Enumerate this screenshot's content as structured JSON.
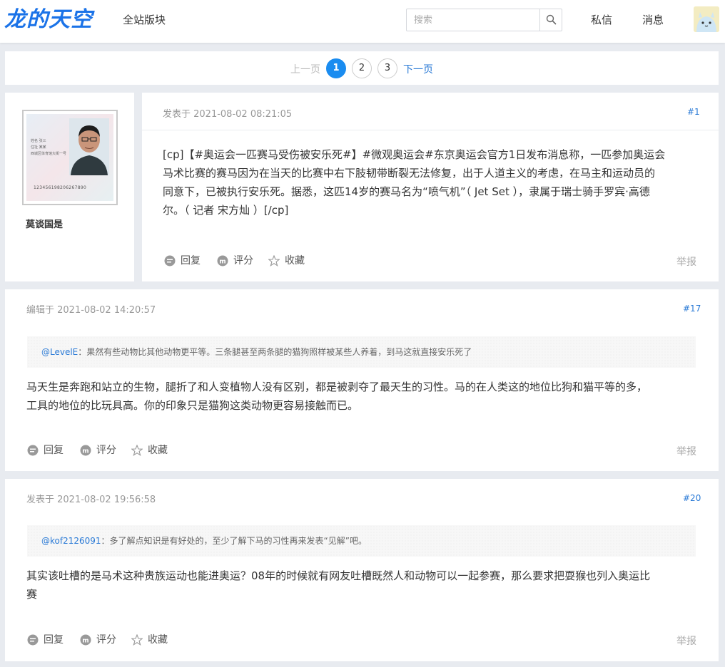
{
  "header": {
    "logo": "龙的天空",
    "nav_all": "全站版块",
    "search_placeholder": "搜索",
    "messages_label": "私信",
    "notifications_label": "消息"
  },
  "pager": {
    "prev": "上一页",
    "pages": [
      "1",
      "2",
      "3"
    ],
    "current": "1",
    "next": "下一页"
  },
  "op": {
    "username": "莫谈国是",
    "date": "发表于 2021-08-02 08:21:05",
    "floor": "#1",
    "lines": [
      "[cp]【#奥运会一匹赛马受伤被安乐死#】#微观奥运会#东京奥运会官方1日发布消息称，一匹参加奥运会",
      "马术比赛的赛马因为在当天的比赛中右下肢韧带断裂无法修复，出于人道主义的考虑，在马主和运动员的",
      "同意下，已被执行安乐死。据悉，这匹14岁的赛马名为“喷气机”（ Jet Set ），隶属于瑞士骑手罗宾·高德",
      "尔。（ 记者 宋方灿 ）[/cp]"
    ],
    "avatar_id_number": "123456198206267890",
    "avatar_id_lines": [
      "姓名 张三",
      "住址 某某",
      "西城区体育馆大街一号"
    ]
  },
  "actions": {
    "reply": "回复",
    "rate": "评分",
    "favorite": "收藏",
    "report": "举报"
  },
  "replies": [
    {
      "date": "编辑于 2021-08-02 14:20:57",
      "floor": "#17",
      "quote_user": "@LevelE",
      "quote_text": "：果然有些动物比其他动物更平等。三条腿甚至两条腿的猫狗照样被某些人养着，到马这就直接安乐死了",
      "lines": [
        "马天生是奔跑和站立的生物，腿折了和人变植物人没有区别，都是被剥夺了最天生的习性。马的在人类这的地位比狗和猫平等的多，",
        "工具的地位的比玩具高。你的印象只是猫狗这类动物更容易接触而已。"
      ]
    },
    {
      "date": "发表于 2021-08-02 19:56:58",
      "floor": "#20",
      "quote_user": "@kof2126091",
      "quote_text": "：多了解点知识是有好处的，至少了解下马的习性再来发表“见解”吧。",
      "lines": [
        "其实该吐槽的是马术这种贵族运动也能进奥运？08年的时候就有网友吐槽既然人和动物可以一起参赛，那么要求把耍猴也列入奥运比",
        "赛"
      ]
    }
  ],
  "colors": {
    "accent": "#1a8cf0",
    "link": "#2a7ad6",
    "page_bg": "#e8ebf0"
  }
}
